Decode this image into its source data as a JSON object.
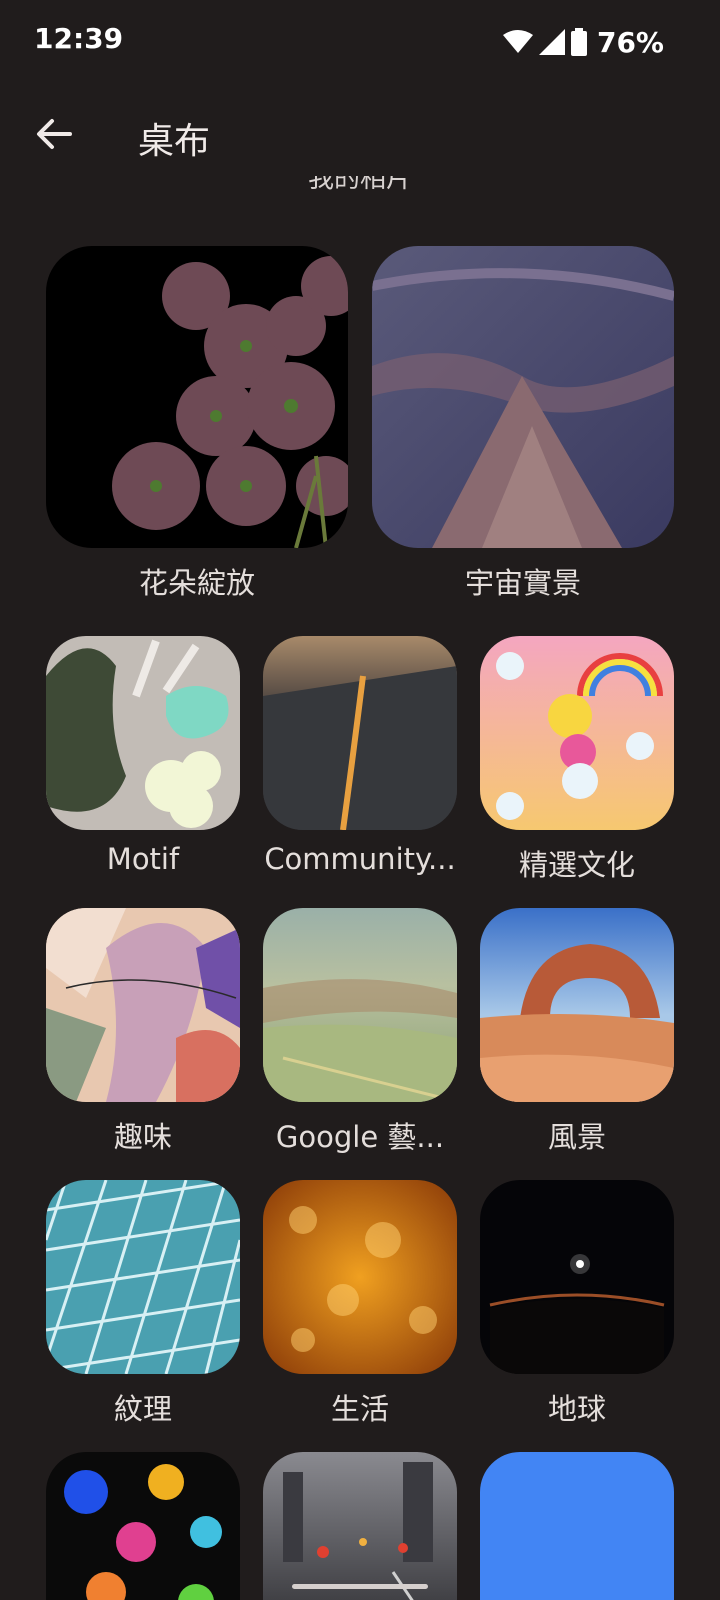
{
  "status_bar": {
    "time": "12:39",
    "battery": "76%",
    "icons": [
      "wifi-icon",
      "cell-signal-icon",
      "battery-icon"
    ]
  },
  "app_bar": {
    "title": "桌布",
    "back_icon": "arrow-back-icon"
  },
  "section": {
    "header": "我的相片"
  },
  "collections": [
    {
      "label": "花朵綻放",
      "thumb": "dark flowers"
    },
    {
      "label": "宇宙實景",
      "thumb": "canyon rock"
    },
    {
      "label": "Motif",
      "thumb": "abstract shapes"
    },
    {
      "label": "Community...",
      "thumb": "firefall cliff"
    },
    {
      "label": "精選文化",
      "thumb": "cartoon rainbow"
    },
    {
      "label": "趣味",
      "thumb": "abstract art"
    },
    {
      "label": "Google 藝...",
      "thumb": "painted landscape"
    },
    {
      "label": "風景",
      "thumb": "desert arch"
    },
    {
      "label": "紋理",
      "thumb": "glass facade"
    },
    {
      "label": "生活",
      "thumb": "orange bokeh"
    },
    {
      "label": "地球",
      "thumb": "earth horizon"
    },
    {
      "label": "",
      "thumb": "paint splash"
    },
    {
      "label": "",
      "thumb": "rainy street"
    },
    {
      "label": "",
      "thumb": "solid blue"
    }
  ],
  "colors": {
    "background": "#201c1c",
    "text": "#e4dedb",
    "solid_blue": "#4285f4"
  }
}
